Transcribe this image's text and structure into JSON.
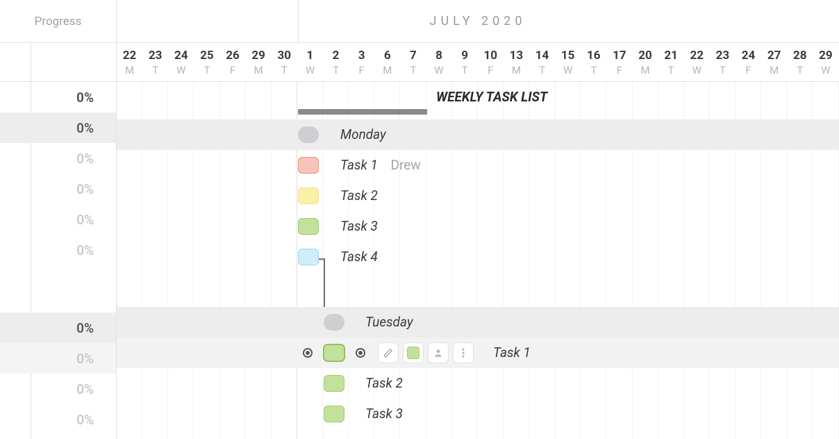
{
  "sidebar": {
    "header": "Progress",
    "rows": [
      {
        "value": "0%",
        "style": "bold"
      },
      {
        "value": "0%",
        "style": "highlight"
      },
      {
        "value": "0%",
        "style": "light"
      },
      {
        "value": "0%",
        "style": "light"
      },
      {
        "value": "0%",
        "style": "light"
      },
      {
        "value": "0%",
        "style": "light"
      },
      {
        "value": "",
        "style": "spacer"
      },
      {
        "value": "0%",
        "style": "highlight"
      },
      {
        "value": "0%",
        "style": "alt-highlight light"
      },
      {
        "value": "0%",
        "style": "light"
      },
      {
        "value": "0%",
        "style": "light"
      }
    ]
  },
  "timeline": {
    "month": "JULY 2020",
    "days": [
      {
        "n": "22",
        "d": "M"
      },
      {
        "n": "23",
        "d": "T"
      },
      {
        "n": "24",
        "d": "W"
      },
      {
        "n": "25",
        "d": "T"
      },
      {
        "n": "26",
        "d": "F"
      },
      {
        "n": "29",
        "d": "M"
      },
      {
        "n": "30",
        "d": "T"
      },
      {
        "n": "1",
        "d": "W"
      },
      {
        "n": "2",
        "d": "T"
      },
      {
        "n": "3",
        "d": "F"
      },
      {
        "n": "6",
        "d": "M"
      },
      {
        "n": "7",
        "d": "T"
      },
      {
        "n": "8",
        "d": "W"
      },
      {
        "n": "9",
        "d": "T"
      },
      {
        "n": "10",
        "d": "F"
      },
      {
        "n": "13",
        "d": "M"
      },
      {
        "n": "14",
        "d": "T"
      },
      {
        "n": "15",
        "d": "W"
      },
      {
        "n": "16",
        "d": "T"
      },
      {
        "n": "17",
        "d": "F"
      },
      {
        "n": "20",
        "d": "M"
      },
      {
        "n": "21",
        "d": "T"
      },
      {
        "n": "22",
        "d": "W"
      },
      {
        "n": "23",
        "d": "T"
      },
      {
        "n": "24",
        "d": "F"
      },
      {
        "n": "27",
        "d": "M"
      },
      {
        "n": "28",
        "d": "T"
      },
      {
        "n": "29",
        "d": "W"
      }
    ]
  },
  "gantt": {
    "title": "WEEKLY TASK LIST",
    "monday": {
      "group_label": "Monday",
      "tasks": [
        {
          "label": "Task 1",
          "assignee": "Drew",
          "color": "red"
        },
        {
          "label": "Task 2",
          "assignee": "",
          "color": "yellow"
        },
        {
          "label": "Task 3",
          "assignee": "",
          "color": "green"
        },
        {
          "label": "Task 4",
          "assignee": "",
          "color": "blue"
        }
      ]
    },
    "tuesday": {
      "group_label": "Tuesday",
      "tasks": [
        {
          "label": "Task 1",
          "assignee": "",
          "color": "green"
        },
        {
          "label": "Task 2",
          "assignee": "",
          "color": "green"
        },
        {
          "label": "Task 3",
          "assignee": "",
          "color": "green"
        }
      ]
    },
    "toolbar": {
      "color": "green"
    }
  },
  "colors": {
    "red": "#f7c4ba",
    "yellow": "#f9f1a6",
    "green": "#c3e19b",
    "blue": "#cdeefa",
    "gray": "#cfcfd3"
  }
}
